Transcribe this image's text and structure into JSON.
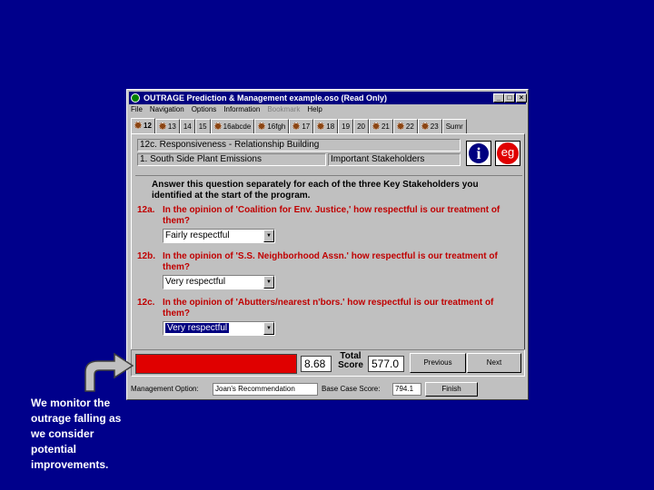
{
  "window": {
    "title": "OUTRAGE Prediction & Management   example.oso (Read Only)",
    "minimize": "_",
    "maximize": "□",
    "close": "×"
  },
  "menu": [
    "File",
    "Navigation",
    "Options",
    "Information",
    "Bookmark",
    "Help"
  ],
  "tabs": [
    {
      "label": "12",
      "icon": true,
      "active": true
    },
    {
      "label": "13",
      "icon": true
    },
    {
      "label": "14",
      "icon": false
    },
    {
      "label": "15",
      "icon": false
    },
    {
      "label": "16abcde",
      "icon": true
    },
    {
      "label": "16fgh",
      "icon": true
    },
    {
      "label": "17",
      "icon": true
    },
    {
      "label": "18",
      "icon": true
    },
    {
      "label": "19",
      "icon": false
    },
    {
      "label": "20",
      "icon": false
    },
    {
      "label": "21",
      "icon": true
    },
    {
      "label": "22",
      "icon": true
    },
    {
      "label": "23",
      "icon": true
    },
    {
      "label": "Sumr",
      "icon": false
    }
  ],
  "header": {
    "section_title": "12c. Responsiveness - Relationship Building",
    "issue": "1. South Side Plant Emissions",
    "stakeholders_label": "Important Stakeholders",
    "info_icon_text": "i",
    "eg_text": "eg"
  },
  "intro": "Answer this question separately for each of the three Key Stakeholders you identified at the start of the program.",
  "questions": [
    {
      "num": "12a.",
      "text": "In the opinion of 'Coalition for Env. Justice,' how respectful is our treatment of them?",
      "answer": "Fairly respectful"
    },
    {
      "num": "12b.",
      "text": "In the opinion of 'S.S. Neighborhood Assn.' how respectful is our treatment of them?",
      "answer": "Very respectful"
    },
    {
      "num": "12c.",
      "text": "In the opinion of 'Abutters/nearest n'bors.' how respectful is our treatment of them?",
      "answer": "Very respectful"
    }
  ],
  "score": {
    "meter_level": 1.0,
    "meter_color": "#e00000",
    "value": "8.68",
    "total_label": "Total Score",
    "total": "577.0",
    "previous": "Previous",
    "next": "Next"
  },
  "status": {
    "option_label": "Management Option:",
    "option_value": "Joan's Recommendation",
    "base_label": "Base Case Score:",
    "base_value": "794.1",
    "btn": "Finish"
  },
  "caption": "We monitor the outrage falling as we consider potential improvements."
}
